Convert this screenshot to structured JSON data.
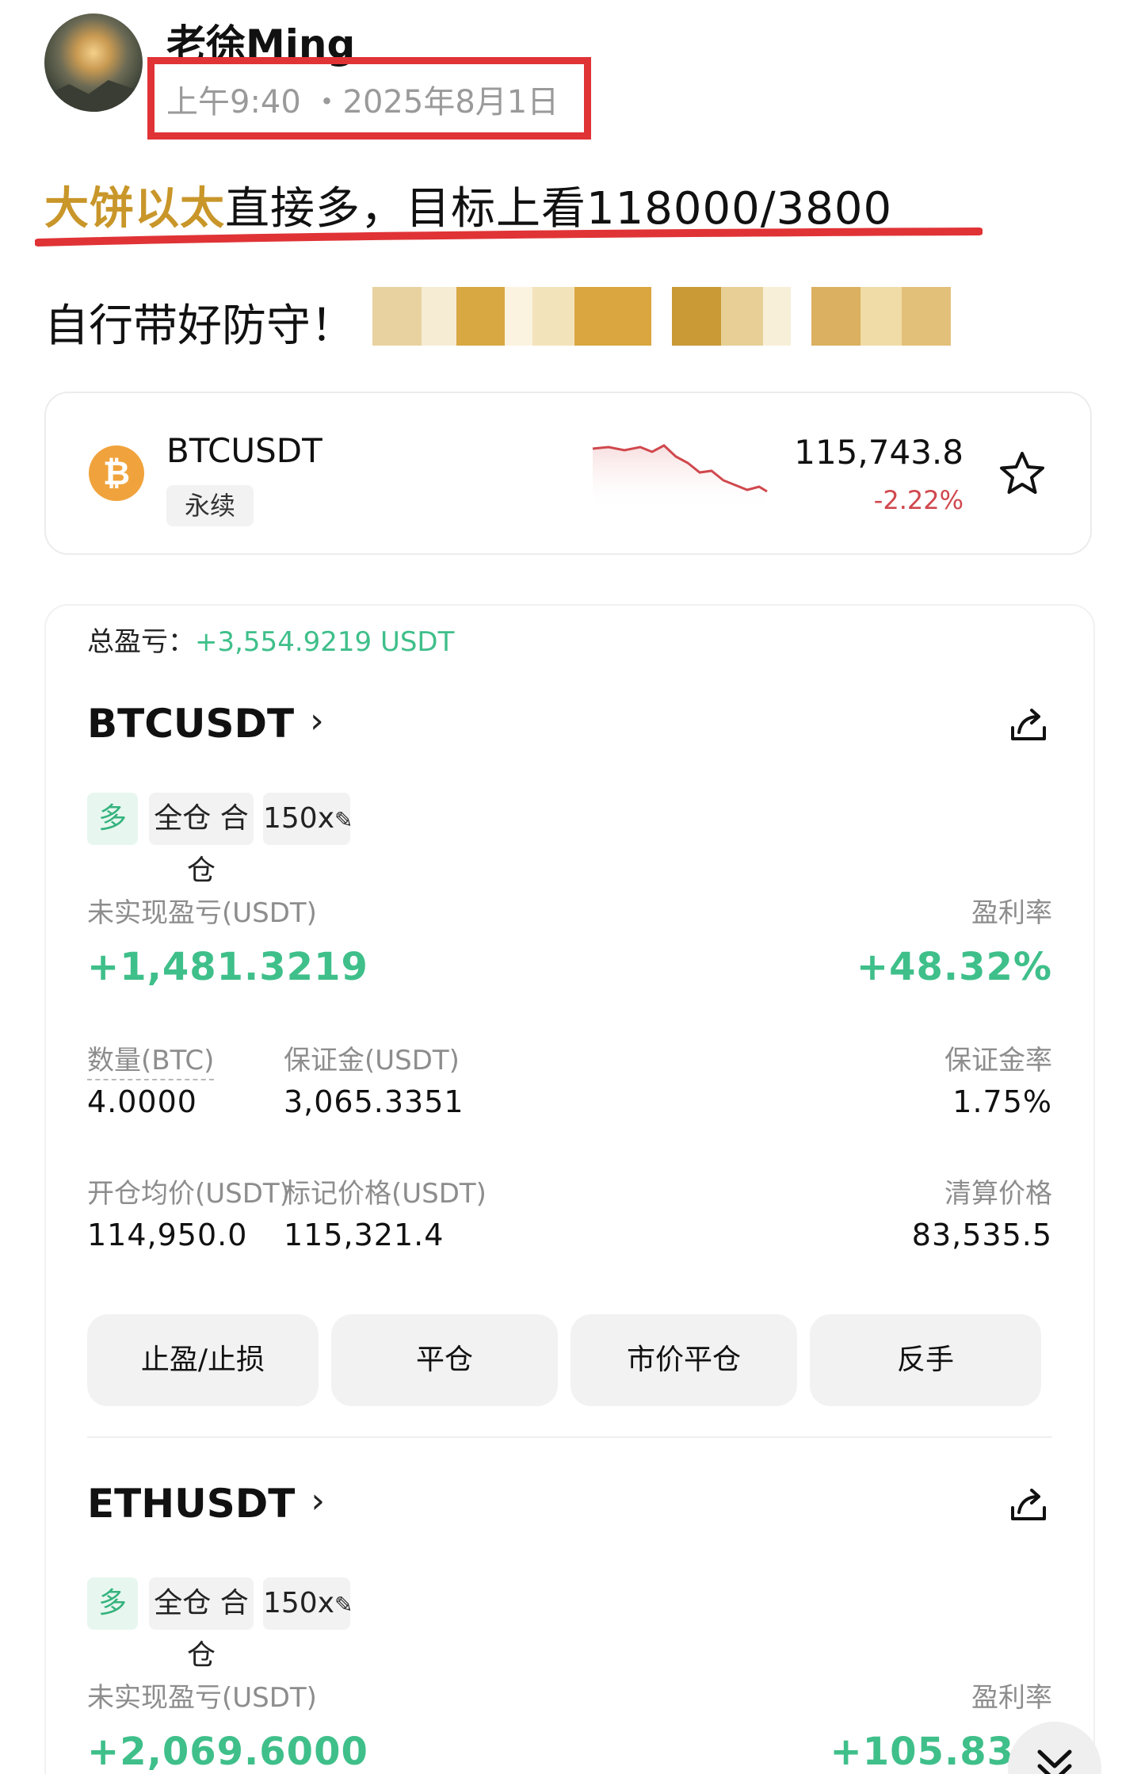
{
  "post": {
    "username": "老徐Ming",
    "timestamp": "上午9:40 ・2025年8月1日",
    "line1_highlight": "大饼以太",
    "line1_rest": "直接多，目标上看118000/3800",
    "line2": "自行带好防守！"
  },
  "ticker": {
    "symbol": "BTCUSDT",
    "badge": "永续",
    "price": "115,743.8",
    "change": "-2.22%",
    "logo_glyph": "₿"
  },
  "positions": {
    "total_pnl_label": "总盈亏：",
    "total_pnl_value": "+3,554.9219 USDT",
    "items": [
      {
        "symbol": "BTCUSDT",
        "side_tag": "多",
        "margin_tag": "全仓 合仓",
        "leverage_tag": "150x",
        "unrealized_label": "未实现盈亏(USDT)",
        "unrealized_value": "+1,481.3219",
        "roi_label": "盈利率",
        "roi_value": "+48.32%",
        "qty_label": "数量(BTC)",
        "qty_value": "4.0000",
        "margin_label": "保证金(USDT)",
        "margin_value": "3,065.3351",
        "margin_rate_label": "保证金率",
        "margin_rate_value": "1.75%",
        "entry_label": "开仓均价(USDT)",
        "entry_value": "114,950.0",
        "mark_label": "标记价格(USDT)",
        "mark_value": "115,321.4",
        "liq_label": "清算价格",
        "liq_value": "83,535.5",
        "buttons": [
          "止盈/止损",
          "平仓",
          "市价平仓",
          "反手"
        ]
      },
      {
        "symbol": "ETHUSDT",
        "side_tag": "多",
        "margin_tag": "全仓 合仓",
        "leverage_tag": "150x",
        "unrealized_label": "未实现盈亏(USDT)",
        "unrealized_value": "+2,069.6000",
        "roi_label": "盈利率",
        "roi_value": "+105.83"
      }
    ]
  },
  "colors": {
    "accent_red": "#e03336",
    "highlight_gold": "#c9962a",
    "profit_green": "#3fbf8a",
    "loss_red": "#d0484d",
    "btc_orange": "#f0a33c"
  }
}
